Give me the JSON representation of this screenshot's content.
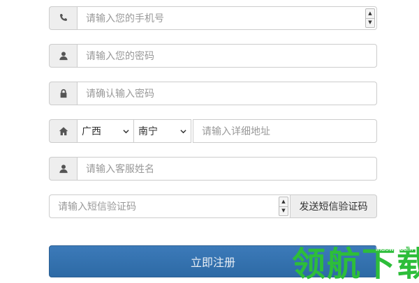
{
  "form": {
    "phone": {
      "placeholder": "请输入您的手机号",
      "icon": "phone-icon"
    },
    "password": {
      "placeholder": "请输入您的密码",
      "icon": "user-icon"
    },
    "confirm_password": {
      "placeholder": "请确认输入密码",
      "icon": "lock-icon"
    },
    "address": {
      "icon": "home-icon",
      "province": "广西",
      "city": "南宁",
      "detail_placeholder": "请输入详细地址"
    },
    "service_name": {
      "placeholder": "请输入客服姓名",
      "icon": "user-icon"
    },
    "sms": {
      "placeholder": "请输入短信验证码",
      "button_label": "发送短信验证码"
    },
    "submit_label": "立即注册"
  },
  "watermark": {
    "text": "领航下载",
    "url": "lhdown.com"
  },
  "colors": {
    "primary": "#2d6aa5",
    "watermark": "#2dbd3a",
    "addon_bg": "#eeeeee",
    "border": "#cccccc"
  }
}
